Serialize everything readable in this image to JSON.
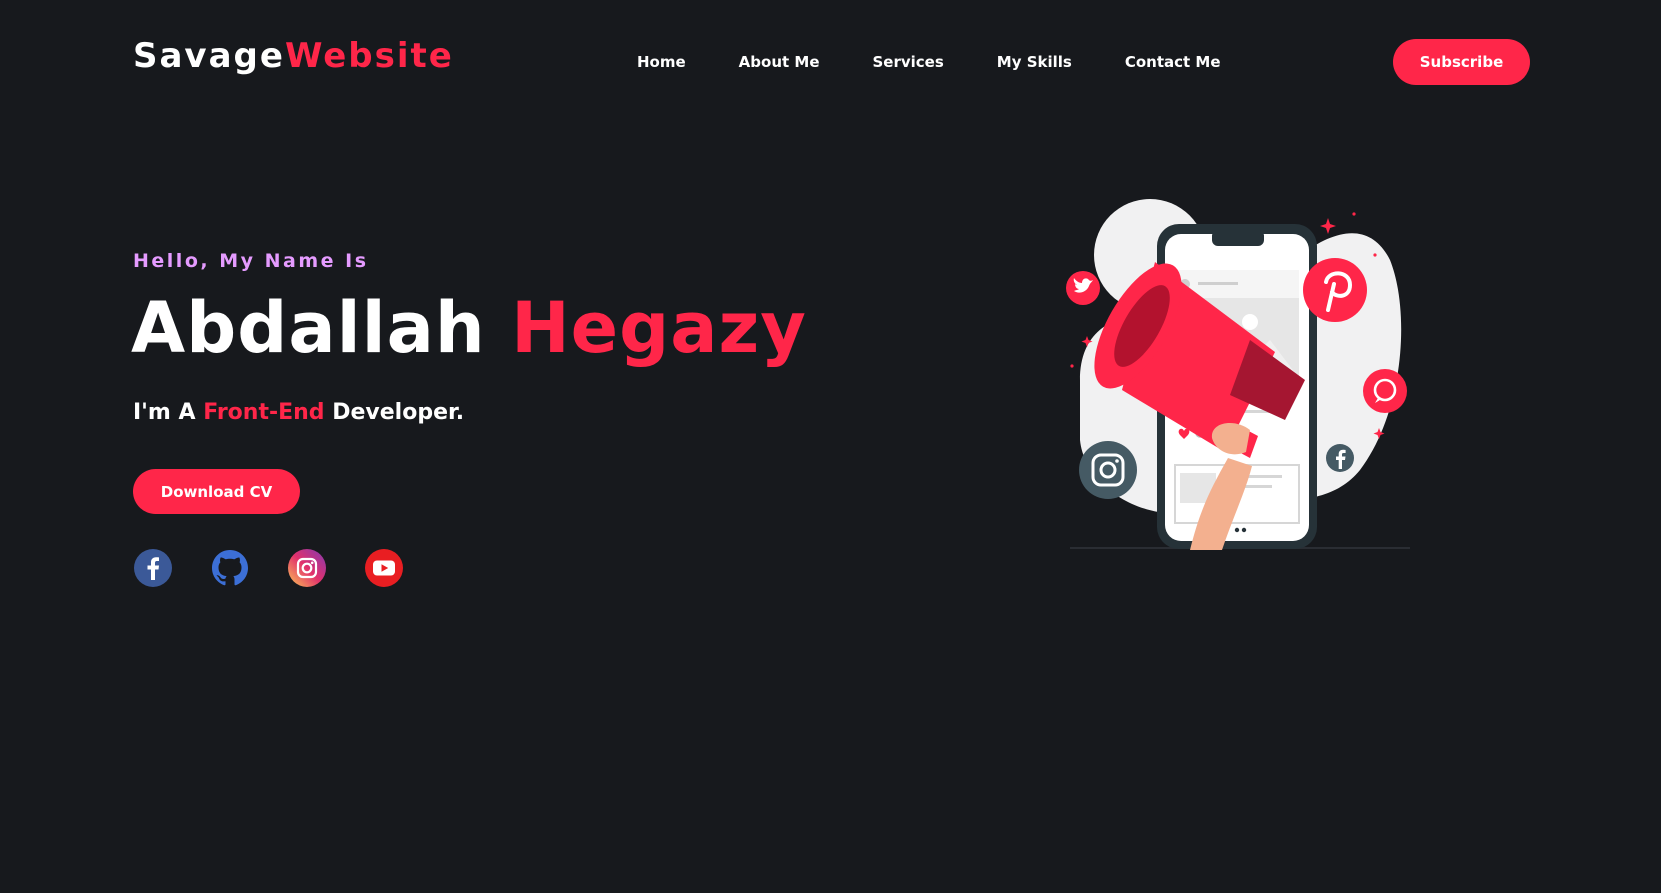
{
  "header": {
    "logo_part1": "Savage",
    "logo_part2": "Website",
    "nav": [
      "Home",
      "About Me",
      "Services",
      "My Skills",
      "Contact Me"
    ],
    "subscribe_label": "Subscribe"
  },
  "hero": {
    "greeting": "Hello, My Name Is",
    "first_name": "Abdallah",
    "last_name": "Hegazy",
    "role_prefix": "I'm A",
    "role_highlight": "Front-End",
    "role_suffix": "Developer.",
    "cv_label": "Download CV",
    "socials": [
      "facebook-icon",
      "github-icon",
      "instagram-icon",
      "youtube-icon"
    ]
  },
  "colors": {
    "background": "#17191d",
    "accent": "#ff2649",
    "greeting": "#e59bff"
  }
}
